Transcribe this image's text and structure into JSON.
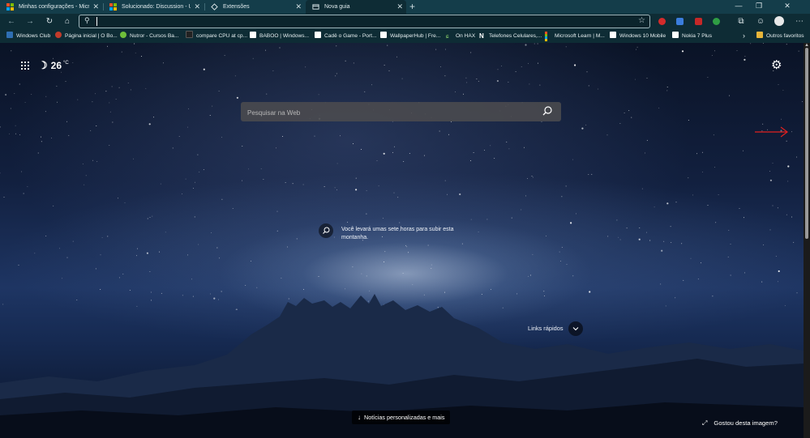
{
  "tabs": [
    {
      "title": "Minhas configurações - Microsof",
      "favicon": "microsoft-logo-icon"
    },
    {
      "title": "Solucionado: Discussion - Updat",
      "favicon": "microsoft-logo-icon"
    },
    {
      "title": "Extensões",
      "favicon": "extensions-icon"
    },
    {
      "title": "Nova guia",
      "favicon": "new-tab-page-icon",
      "active": true
    }
  ],
  "toolbar": {
    "address_value": "",
    "icons": [
      "back-icon",
      "forward-icon",
      "refresh-icon",
      "home-icon",
      "search-icon",
      "favorite-star-icon",
      "collections-icon",
      "profile-avatar-icon",
      "settings-more-icon"
    ]
  },
  "bookmarks": [
    {
      "label": "Windows Club",
      "icon_color": "#2f6fb3"
    },
    {
      "label": "Página inicial | O Bo...",
      "icon_color": "#c23b2b"
    },
    {
      "label": "Nutror - Cursos Ba...",
      "icon_color": "#6fbf3a"
    },
    {
      "label": "compare CPU at cp...",
      "icon_color": "#222222"
    },
    {
      "label": "BABOO | Windows...",
      "icon_color": "#ffffff"
    },
    {
      "label": "Cadê o Game - Port...",
      "icon_color": "#ffffff"
    },
    {
      "label": "WallpaperHub | Fre...",
      "icon_color": "#ffffff"
    },
    {
      "label": "On HAX",
      "icon_color": "#0e2c35"
    },
    {
      "label": "Telefones Celulares,...",
      "icon_color": "#1b5fbf"
    },
    {
      "label": "Microsoft Learn | M...",
      "icon_color": "#f25022"
    },
    {
      "label": "Windows 10 Mobile",
      "icon_color": "#ffffff"
    },
    {
      "label": "Nokia 7 Plus",
      "icon_color": "#ffffff"
    }
  ],
  "bookmarks_overflow": "Outros favoritos",
  "weather": {
    "temperature": "26",
    "unit": "°C",
    "condition_icon": "moon-icon"
  },
  "search": {
    "placeholder": "Pesquisar na Web"
  },
  "image_caption": "Você levará umas sete horas para subir esta montanha.",
  "quick_links_label": "Links rápidos",
  "news_button_label": "Notícias personalizadas e mais",
  "like_image_label": "Gostou desta imagem?",
  "colors": {
    "tabstrip": "#143d4a",
    "toolbar": "#0e2c35",
    "annotation_arrow": "#e02020"
  }
}
